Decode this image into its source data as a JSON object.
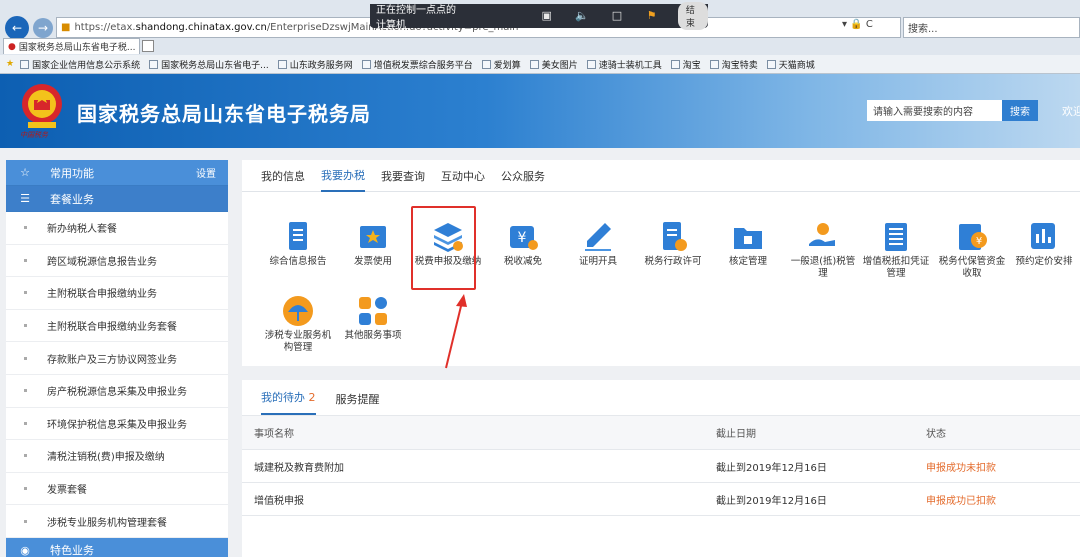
{
  "browser": {
    "url_prefix": "https://etax.",
    "url_domain": "shandong.chinatax.gov.cn",
    "url_path": "/EnterpriseDzswjMainAction.do?activity=pre_main",
    "url_right": "▾ 🔒 C",
    "search_placeholder": "搜索...",
    "tab_title": "国家税务总局山东省电子税...",
    "favorites": [
      "国家企业信用信息公示系统",
      "国家税务总局山东省电子...",
      "山东政务服务网",
      "增值税发票综合服务平台",
      "爱划算",
      "美女图片",
      "速骑士装机工具",
      "淘宝",
      "淘宝特卖",
      "天猫商城"
    ]
  },
  "remote": {
    "title": "正在控制一点点的计算机",
    "end_label": "结束",
    "icons": [
      "window-icon",
      "mute-icon",
      "screenshot-icon",
      "pin-icon"
    ]
  },
  "header": {
    "emblem_text": "中国税务",
    "title": "国家税务总局山东省电子税务局",
    "search_placeholder": "请输入需要搜索的内容",
    "search_button": "搜索",
    "welcome": "欢迎"
  },
  "sidebar": {
    "common": {
      "label": "常用功能",
      "settings": "设置"
    },
    "package": {
      "label": "套餐业务"
    },
    "items": [
      "新办纳税人套餐",
      "跨区域税源信息报告业务",
      "主附税联合申报缴纳业务",
      "主附税联合申报缴纳业务套餐",
      "存款账户及三方协议网签业务",
      "房产税税源信息采集及申报业务",
      "环境保护税信息采集及申报业务",
      "清税注销税(费)申报及缴纳",
      "发票套餐",
      "涉税专业服务机构管理套餐"
    ],
    "special": {
      "label": "特色业务"
    }
  },
  "main": {
    "tabs": [
      "我的信息",
      "我要办税",
      "我要查询",
      "互动中心",
      "公众服务"
    ],
    "active_tab": 1,
    "services": [
      {
        "label": "综合信息报告",
        "icon": "report-icon",
        "color": "#2f7fd6"
      },
      {
        "label": "发票使用",
        "icon": "invoice-icon",
        "color": "#2f7fd6"
      },
      {
        "label": "税费申报及缴纳",
        "icon": "tax-filing-icon",
        "color": "#2f7fd6"
      },
      {
        "label": "税收减免",
        "icon": "tax-reduction-icon",
        "color": "#2f7fd6"
      },
      {
        "label": "证明开具",
        "icon": "certificate-icon",
        "color": "#2f7fd6"
      },
      {
        "label": "税务行政许可",
        "icon": "permit-icon",
        "color": "#2f7fd6"
      },
      {
        "label": "核定管理",
        "icon": "folder-icon",
        "color": "#2f7fd6"
      },
      {
        "label": "一般退(抵)税管理",
        "icon": "refund-icon",
        "color": "#2f7fd6"
      },
      {
        "label": "增值税抵扣凭证管理",
        "icon": "vat-voucher-icon",
        "color": "#2f7fd6"
      },
      {
        "label": "税务代保管资金收取",
        "icon": "custody-icon",
        "color": "#2f7fd6"
      },
      {
        "label": "预约定价安排",
        "icon": "pricing-icon",
        "color": "#2f7fd6"
      },
      {
        "label": "涉税专业服务机构管理",
        "icon": "umbrella-icon",
        "color": "#f39a1e"
      },
      {
        "label": "其他服务事项",
        "icon": "grid-icon",
        "color": "#f39a1e"
      }
    ],
    "highlight_color": "#e0302a"
  },
  "todo": {
    "tabs": [
      {
        "label": "我的待办",
        "count": "2"
      },
      {
        "label": "服务提醒",
        "count": ""
      }
    ],
    "headers": [
      "事项名称",
      "截止日期",
      "状态"
    ],
    "rows": [
      {
        "name": "城建税及教育费附加",
        "deadline": "截止到2019年12月16日",
        "status": "申报成功未扣款"
      },
      {
        "name": "增值税申报",
        "deadline": "截止到2019年12月16日",
        "status": "申报成功已扣款"
      }
    ]
  }
}
